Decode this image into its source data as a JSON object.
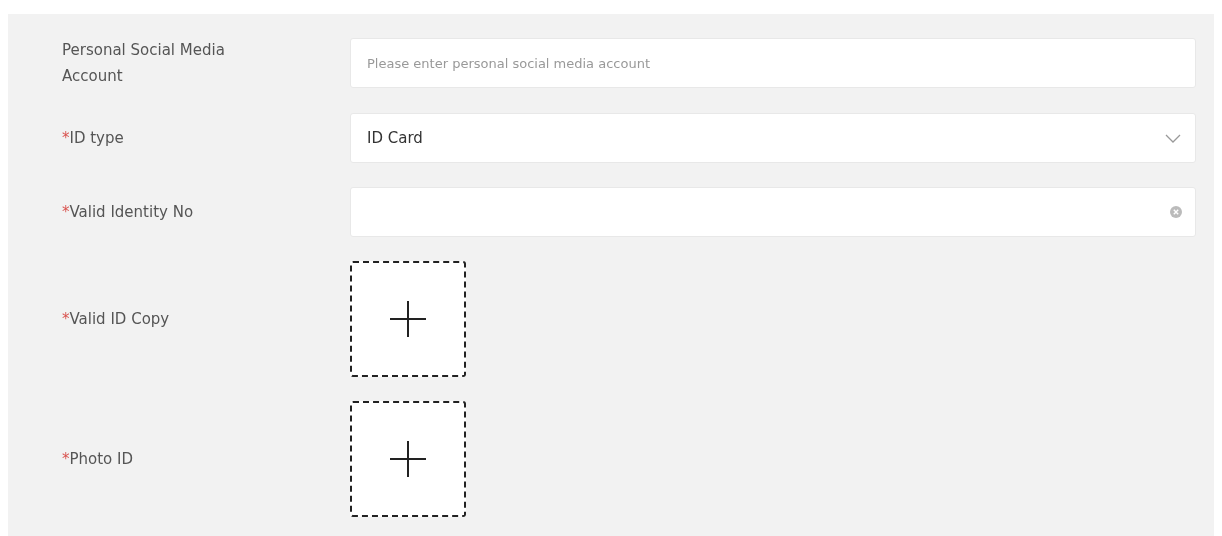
{
  "fields": [
    {
      "kind": "text",
      "label": "Personal Social Media Account",
      "placeholder": "Please enter personal social media account"
    },
    {
      "kind": "select",
      "required_mark": "*",
      "label": "ID type",
      "value": "ID Card"
    },
    {
      "kind": "clearable",
      "required_mark": "*",
      "label": "Valid Identity No"
    },
    {
      "kind": "upload",
      "required_mark": "*",
      "label": "Valid ID Copy"
    },
    {
      "kind": "upload",
      "required_mark": "*",
      "label": "Photo ID"
    }
  ]
}
